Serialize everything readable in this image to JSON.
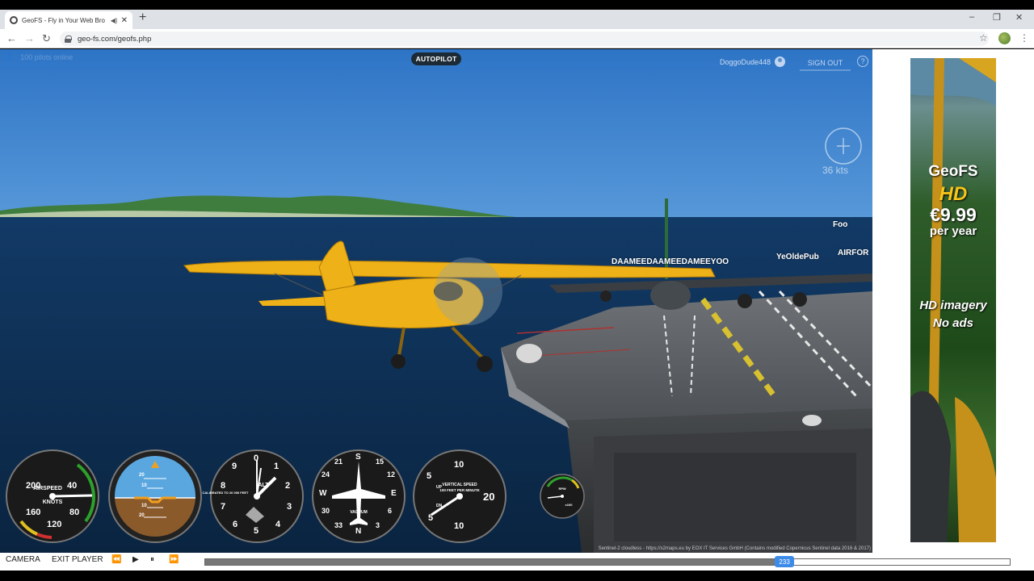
{
  "browser": {
    "tab_title": "GeoFS - Fly in Your Web Bro",
    "tab_audio_icon": "speaker-icon",
    "url": "geo-fs.com/geofs.php",
    "window_controls": [
      "–",
      "❐",
      "✕"
    ]
  },
  "game": {
    "people_count": "100 pilots online",
    "autopilot_label": "AUTOPILOT",
    "username": "DoggoDude448",
    "signout_label": "SIGN OUT",
    "help_label": "?",
    "wind_speed": "36 kts",
    "labels": {
      "player1": "DAAMEEDAAMEEDAMEEYOO",
      "player2": "YeOldePub",
      "player3": "Foo",
      "player4": "AIRFOR"
    },
    "attribution": "Sentinel-2 cloudless - https://s2maps.eu by EOX IT Services GmbH (Contains modified Copernicus Sentinel data 2016 & 2017)",
    "gauges": {
      "airspeed": {
        "title": "AIRSPEED",
        "unit": "KNOTS",
        "ticks": [
          "40",
          "80",
          "120",
          "160",
          "200"
        ],
        "needle_knots": 65
      },
      "attitude": {
        "ticks": [
          "20",
          "10",
          "10",
          "20"
        ]
      },
      "altimeter": {
        "title": "ALT",
        "sub": "CALIBRATED TO 20 000 FEET",
        "ticks": [
          "0",
          "1",
          "2",
          "3",
          "4",
          "5",
          "6",
          "7",
          "8",
          "9"
        ]
      },
      "heading": {
        "title": "VACUUM",
        "ticks": [
          "N",
          "3",
          "6",
          "E",
          "12",
          "15",
          "S",
          "21",
          "24",
          "W",
          "30",
          "33"
        ]
      },
      "vsi": {
        "title": "VERTICAL SPEED",
        "sub": "100 FEET PER MINUTE",
        "ticks": [
          "10",
          "5",
          "20",
          "10",
          "5"
        ],
        "label_up": "UP",
        "label_down": "DN"
      },
      "rpm": {
        "title": "RPM",
        "sub": "x100"
      }
    }
  },
  "ad": {
    "brand": "GeoFS",
    "hd": "HD",
    "price": "€9.99",
    "period": "per year",
    "line1": "HD imagery",
    "line2": "No ads"
  },
  "player": {
    "camera_label": "CAMERA",
    "exit_label": "EXIT PLAYER",
    "rewind_icon": "⏪",
    "play_icon": "▶",
    "pause_icon": "⏸",
    "forward_icon": "⏩",
    "position_value": "233",
    "progress_fraction": 0.72
  }
}
